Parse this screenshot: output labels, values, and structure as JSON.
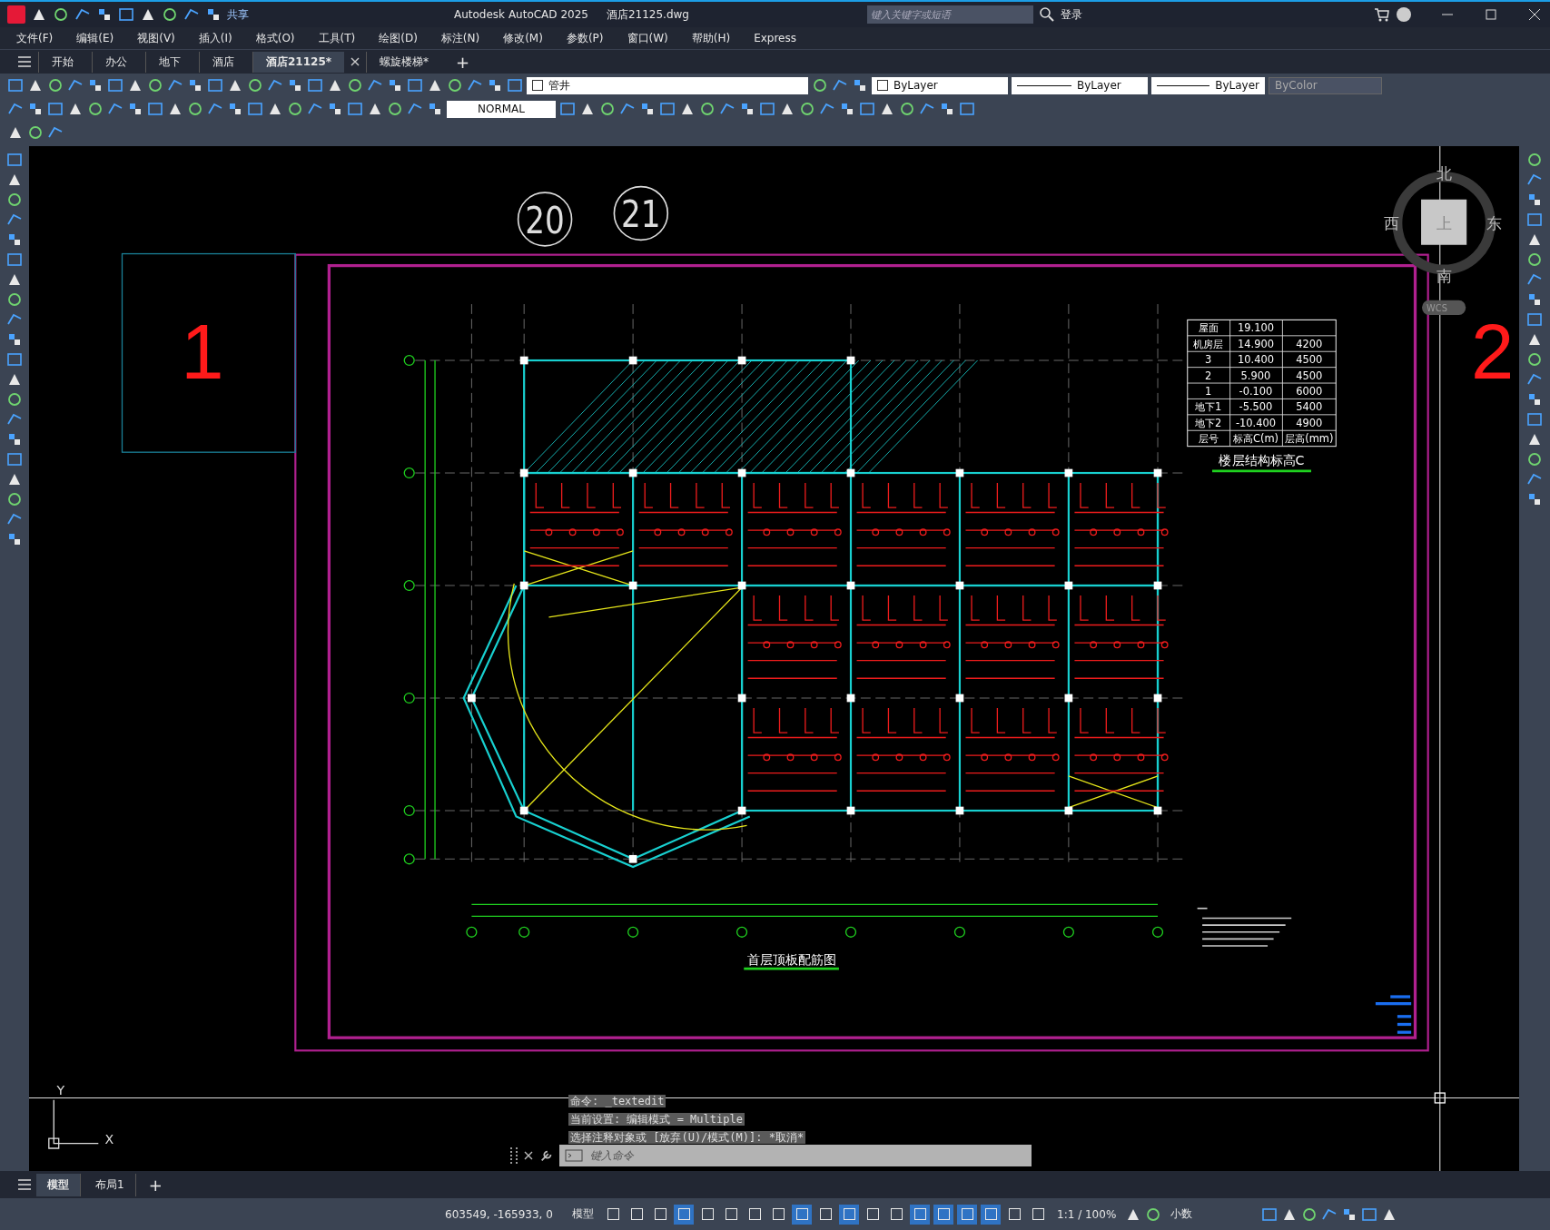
{
  "title_bar": {
    "share": "共享",
    "app_title": "Autodesk AutoCAD 2025",
    "file_name": "酒店21125.dwg",
    "search": {
      "placeholder": "键入关键字或短语"
    },
    "sign_in": "登录"
  },
  "menu": [
    "文件(F)",
    "编辑(E)",
    "视图(V)",
    "插入(I)",
    "格式(O)",
    "工具(T)",
    "绘图(D)",
    "标注(N)",
    "修改(M)",
    "参数(P)",
    "窗口(W)",
    "帮助(H)",
    "Express"
  ],
  "file_tabs": [
    {
      "label": "开始",
      "selected": false
    },
    {
      "label": "办公",
      "selected": false
    },
    {
      "label": "地下",
      "selected": false
    },
    {
      "label": "酒店",
      "selected": false
    },
    {
      "label": "酒店21125*",
      "selected": true
    },
    {
      "label": "螺旋楼梯*",
      "selected": false
    }
  ],
  "new_tab": "+",
  "properties": {
    "layer": "管井",
    "dropdowns": [
      "ByLayer",
      "ByLayer",
      "ByLayer"
    ],
    "plot_style": {
      "value": "ByColor",
      "disabled": true
    },
    "text_style": "NORMAL"
  },
  "drawing": {
    "labels": [
      "1",
      "2"
    ],
    "bubbles": [
      "20",
      "21"
    ],
    "title": "首层顶板配筋图",
    "level_table": {
      "title": "楼层结构标高C",
      "rows": [
        [
          "屋面",
          "19.100"
        ],
        [
          "机房层",
          "14.900",
          "4200"
        ],
        [
          "3",
          "10.400",
          "4500"
        ],
        [
          "2",
          "5.900",
          "4500"
        ],
        [
          "1",
          "-0.100",
          "6000"
        ],
        [
          "地下1",
          "-5.500",
          "5400"
        ],
        [
          "地下2",
          "-10.400",
          "4900"
        ],
        [
          "层号",
          "标高C(m)",
          "层高(mm)"
        ]
      ]
    },
    "viewcube": {
      "north": "北",
      "south": "南",
      "west": "西",
      "east": "东",
      "top": "上",
      "coordinate_system": "WCS"
    },
    "ucs": {
      "x": "X",
      "y": "Y"
    }
  },
  "command_line": {
    "history": [
      "命令: _textedit",
      "当前设置: 编辑模式 = Multiple",
      "选择注释对象或 [放弃(U)/模式(M)]: *取消*"
    ],
    "placeholder": "键入命令"
  },
  "layout_tabs": [
    {
      "label": "模型",
      "selected": true
    },
    {
      "label": "布局1",
      "selected": false
    }
  ],
  "new_layout": "+",
  "status_bar": {
    "coordinates": "603549, -165933, 0",
    "space": "模型",
    "toggles": [
      {
        "on": false
      },
      {
        "on": false
      },
      {
        "on": false
      },
      {
        "on": true
      },
      {
        "on": false
      },
      {
        "on": false
      },
      {
        "on": false
      },
      {
        "on": false
      },
      {
        "on": true
      },
      {
        "on": false
      },
      {
        "on": true
      },
      {
        "on": false
      },
      {
        "on": false
      },
      {
        "on": true
      },
      {
        "on": true
      },
      {
        "on": true
      },
      {
        "on": true
      },
      {
        "on": false
      },
      {
        "on": false
      }
    ],
    "annotation_scale": "1:1 / 100%",
    "units": "小数"
  }
}
